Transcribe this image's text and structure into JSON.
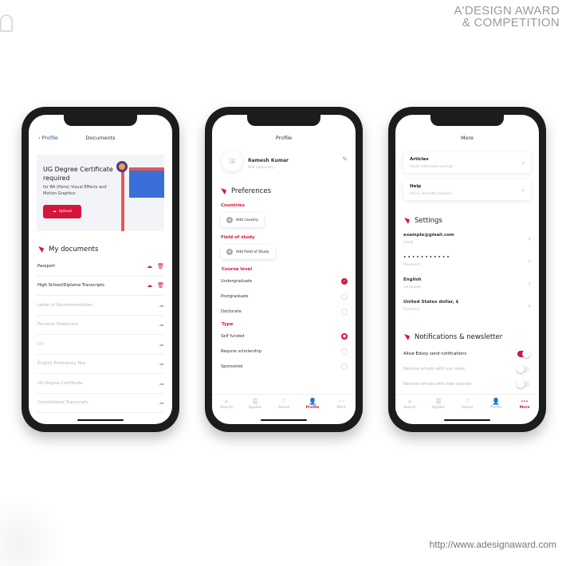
{
  "watermark": {
    "line1": "A'DESIGN AWARD",
    "line2": "& COMPETITION",
    "url": "http://www.adesignaward.com"
  },
  "colors": {
    "accent": "#d6153d",
    "link": "#2a4d8f"
  },
  "documents": {
    "back": "Profile",
    "title": "Documents",
    "banner": {
      "title": "UG Degree Certificate required",
      "subtitle": "for BA (Hons) Visual Effects and Motion Graphics",
      "button": "Upload"
    },
    "section": "My documents",
    "items": [
      {
        "label": "Passport",
        "uploaded": true
      },
      {
        "label": "High School/Diploma Transcripts",
        "uploaded": true
      },
      {
        "label": "Letter of Recommendation",
        "uploaded": false
      },
      {
        "label": "Personal Statement",
        "uploaded": false
      },
      {
        "label": "CV",
        "uploaded": false
      },
      {
        "label": "English Proficiency Test",
        "uploaded": false
      },
      {
        "label": "UG Degree Certificate",
        "uploaded": false
      },
      {
        "label": "Consolidated Transcripts",
        "uploaded": false
      }
    ]
  },
  "profile": {
    "title": "Profile",
    "name": "Ramesh Kumar",
    "nationality_placeholder": "Add nationality",
    "section": "Preferences",
    "countries_label": "Countries",
    "add_country": "Add country",
    "field_label": "Field of study",
    "add_field": "Add Field of Study",
    "course_label": "Course level",
    "course_options": [
      {
        "label": "Undergraduate",
        "selected": true
      },
      {
        "label": "Postgraduate",
        "selected": false
      },
      {
        "label": "Doctorate",
        "selected": false
      }
    ],
    "type_label": "Type",
    "type_options": [
      {
        "label": "Self funded",
        "selected": true
      },
      {
        "label": "Require scholarship",
        "selected": false
      },
      {
        "label": "Sponsored",
        "selected": false
      }
    ]
  },
  "tabs": [
    {
      "label": "Search",
      "icon": "search-icon",
      "glyph": "⌕"
    },
    {
      "label": "Applies",
      "icon": "list-icon",
      "glyph": "☰"
    },
    {
      "label": "Saved",
      "icon": "heart-icon",
      "glyph": "♡"
    },
    {
      "label": "Profile",
      "icon": "user-icon",
      "glyph": "👤"
    },
    {
      "label": "More",
      "icon": "more-icon",
      "glyph": "···"
    }
  ],
  "more": {
    "title": "More",
    "cards": [
      {
        "title": "Articles",
        "subtitle": "Useful information and tips"
      },
      {
        "title": "Help",
        "subtitle": "FAQ & chat with counselor"
      }
    ],
    "settings_section": "Settings",
    "settings": [
      {
        "value": "example@gmail.com",
        "label": "email"
      },
      {
        "value": "• • • • • • • • • • •",
        "label": "Password"
      },
      {
        "value": "English",
        "label": "Language"
      },
      {
        "value": "United States dollar, $",
        "label": "Currency"
      }
    ],
    "notif_section": "Notifications & newsletter",
    "notifications": [
      {
        "label": "Allow Edvoy send notifications",
        "on": true
      },
      {
        "label": "Receive emails with our news",
        "on": false
      },
      {
        "label": "Receive emails with new courses",
        "on": false
      }
    ]
  }
}
